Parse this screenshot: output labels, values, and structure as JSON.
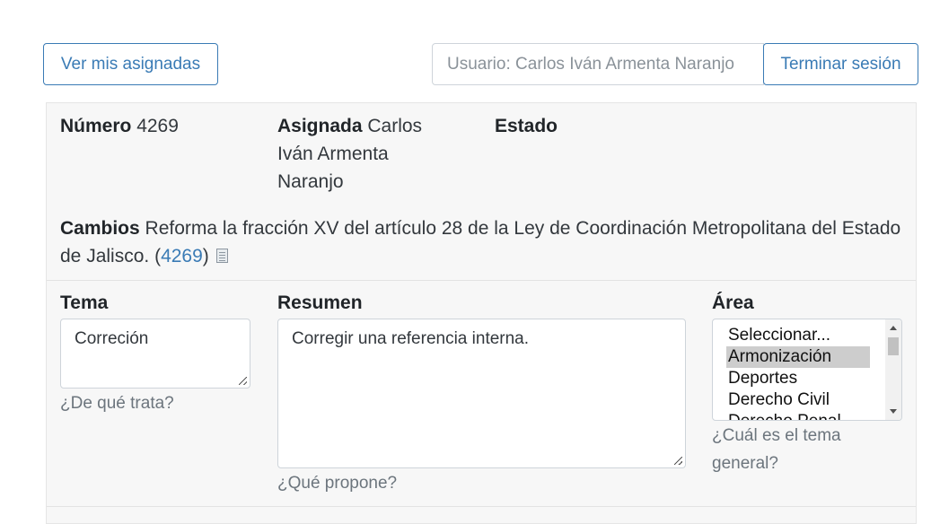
{
  "header": {
    "my_assigned_label": "Ver mis asignadas",
    "user_text": "Usuario: Carlos Iván Armenta Naranjo",
    "logout_label": "Terminar sesión"
  },
  "record": {
    "numero_label": "Número",
    "numero_value": "4269",
    "asignada_label": "Asignada",
    "asignada_value": "Carlos Iván Armenta Naranjo",
    "estado_label": "Estado",
    "estado_value": "",
    "cambios_label": "Cambios",
    "cambios_text": "Reforma la fracción XV del artículo 28 de la Ley de Coordinación Metropolitana del Estado de Jalisco.",
    "cambios_link": "4269",
    "cambios_open": "(",
    "cambios_close": ")"
  },
  "form": {
    "tema_label": "Tema",
    "tema_value": "Correción",
    "tema_help": "¿De qué trata?",
    "resumen_label": "Resumen",
    "resumen_value": "Corregir una referencia interna.",
    "resumen_help": "¿Qué propone?",
    "area_label": "Área",
    "area_help": "¿Cuál es el tema general?",
    "area_options": [
      "Seleccionar...",
      "Armonización",
      "Deportes",
      "Derecho Civil",
      "Derecho Penal"
    ],
    "area_selected": "Armonización"
  },
  "icons": {
    "document": "document-icon",
    "resize": "resize-grip-icon"
  },
  "colors": {
    "accent": "#3a7bb5",
    "panel_bg": "#f7f7f7",
    "muted": "#6c757d"
  }
}
